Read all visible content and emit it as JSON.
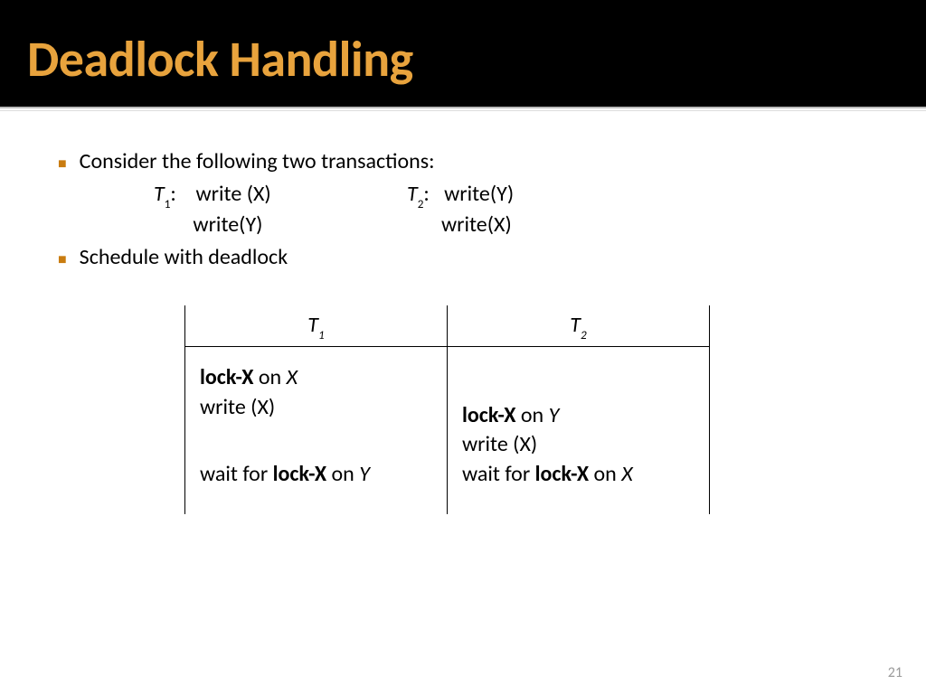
{
  "title": "Deadlock Handling",
  "bullets": {
    "b1": "Consider the following two transactions:",
    "b2": "Schedule with deadlock"
  },
  "trans": {
    "t1_label_pre": "T",
    "t1_label_sub": "1",
    "t1_label_post": ":",
    "t1_l1": "write (X)",
    "t1_l2": "write(Y)",
    "t2_label_pre": "T",
    "t2_label_sub": "2",
    "t2_label_post": ":",
    "t2_l1": "write(Y)",
    "t2_l2": "write(X)"
  },
  "sched": {
    "h1_pre": "T",
    "h1_sub": "1",
    "h2_pre": "T",
    "h2_sub": "2",
    "t1": {
      "r1a": "lock-X",
      "r1b": " on ",
      "r1c": "X",
      "r2": "write (X)",
      "r3a": "wait for ",
      "r3b": "lock-X",
      "r3c": " on ",
      "r3d": "Y"
    },
    "t2": {
      "r1a": "lock-X",
      "r1b": " on ",
      "r1c": "Y",
      "r2": "write (X)",
      "r3a": "wait for ",
      "r3b": "lock-X",
      "r3c": " on ",
      "r3d": "X"
    }
  },
  "page_number": "21"
}
